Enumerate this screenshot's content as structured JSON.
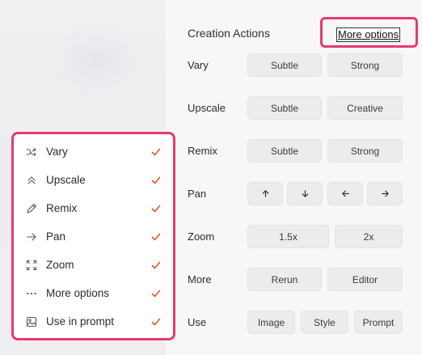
{
  "header": {
    "title": "Creation Actions",
    "more_options_link": "More options"
  },
  "actions": [
    {
      "label": "Vary",
      "buttons": [
        "Subtle",
        "Strong"
      ]
    },
    {
      "label": "Upscale",
      "buttons": [
        "Subtle",
        "Creative"
      ]
    },
    {
      "label": "Remix",
      "buttons": [
        "Subtle",
        "Strong"
      ]
    },
    {
      "label": "Pan",
      "buttons": [
        "arrow-up-icon",
        "arrow-down-icon",
        "arrow-left-icon",
        "arrow-right-icon"
      ]
    },
    {
      "label": "Zoom",
      "buttons": [
        "1.5x",
        "2x"
      ]
    },
    {
      "label": "More",
      "buttons": [
        "Rerun",
        "Editor"
      ]
    },
    {
      "label": "Use",
      "buttons": [
        "Image",
        "Style",
        "Prompt"
      ]
    }
  ],
  "menu": {
    "items": [
      {
        "label": "Vary",
        "icon": "shuffle-icon",
        "checked": true
      },
      {
        "label": "Upscale",
        "icon": "double-chevron-up-icon",
        "checked": true
      },
      {
        "label": "Remix",
        "icon": "pencil-icon",
        "checked": true
      },
      {
        "label": "Pan",
        "icon": "arrow-right-icon",
        "checked": true
      },
      {
        "label": "Zoom",
        "icon": "expand-icon",
        "checked": true
      },
      {
        "label": "More options",
        "icon": "more-dots-icon",
        "checked": true
      },
      {
        "label": "Use in prompt",
        "icon": "image-icon",
        "checked": true
      }
    ]
  },
  "colors": {
    "highlight": "#e53b6d",
    "check": "#e0552b"
  }
}
